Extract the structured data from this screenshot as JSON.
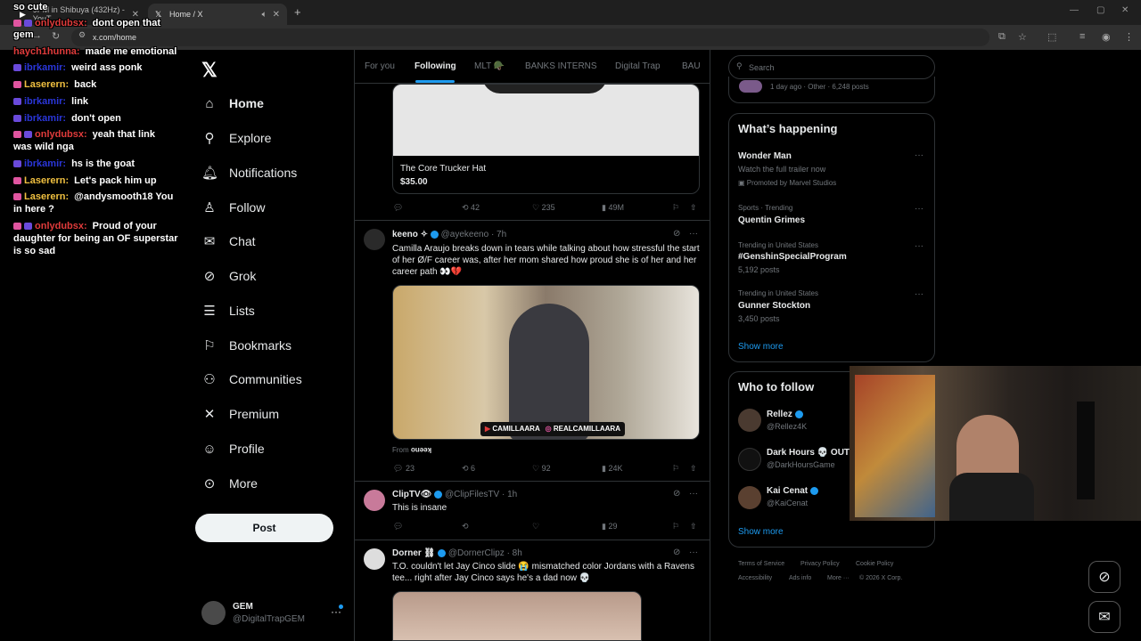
{
  "browser": {
    "tabs": [
      {
        "label": "9PM in Shibuya (432Hz) - YouT",
        "close": "✕"
      },
      {
        "label": "Home / X",
        "close": "✕"
      }
    ],
    "new_tab": "+",
    "url": "x.com/home"
  },
  "sidebar": {
    "logo": "𝕏",
    "items": [
      {
        "label": "Home",
        "icon": "home-icon",
        "glyph": "⌂"
      },
      {
        "label": "Explore",
        "icon": "search-icon",
        "glyph": "⚲"
      },
      {
        "label": "Notifications",
        "icon": "bell-icon",
        "glyph": "🔔︎"
      },
      {
        "label": "Follow",
        "icon": "person-add-icon",
        "glyph": "♙"
      },
      {
        "label": "Chat",
        "icon": "mail-icon",
        "glyph": "✉"
      },
      {
        "label": "Grok",
        "icon": "grok-icon",
        "glyph": "⊘"
      },
      {
        "label": "Lists",
        "icon": "list-icon",
        "glyph": "☰"
      },
      {
        "label": "Bookmarks",
        "icon": "bookmark-icon",
        "glyph": "⚐"
      },
      {
        "label": "Communities",
        "icon": "communities-icon",
        "glyph": "⚇"
      },
      {
        "label": "Premium",
        "icon": "x-icon",
        "glyph": "✕"
      },
      {
        "label": "Profile",
        "icon": "profile-icon",
        "glyph": "☺"
      },
      {
        "label": "More",
        "icon": "more-circle-icon",
        "glyph": "⊙"
      }
    ],
    "post_label": "Post",
    "account": {
      "name": "GEM",
      "handle": "@DigitalTrapGEM",
      "more": "···"
    }
  },
  "feed": {
    "tabs": [
      "For you",
      "Following",
      "MLT 🪖",
      "BANKS INTERNS",
      "Digital Trap",
      "BAU"
    ],
    "active_tab": "Following",
    "post1": {
      "card_title": "The Core Trucker Hat",
      "card_price": "$35.00",
      "replies": "",
      "reposts": "42",
      "likes": "235",
      "views": "49M"
    },
    "post2": {
      "name": "keeno ✧",
      "handle": "@ayekeeno",
      "time": "· 7h",
      "text": "Camilla Araujo breaks down in tears while talking about how stressful the start of her Ø/F career was, after her mom shared how proud she is of her and her career path 👀💔",
      "media_labels": [
        "CAMILLAARA",
        "REALCAMILLAARA"
      ],
      "from": "From",
      "from_name": "keeno",
      "replies": "23",
      "reposts": "6",
      "likes": "92",
      "views": "24K"
    },
    "post3": {
      "name": "ClipTV👁",
      "handle": "@ClipFilesTV",
      "time": "· 1h",
      "text": "This is insane",
      "views": "29"
    },
    "post4": {
      "name": "Dorner ⛓",
      "handle": "@DornerClipz",
      "time": "· 8h",
      "text": "T.O. couldn't let Jay Cinco slide 😭 mismatched color Jordans with a Ravens tee... right after Jay Cinco says he's a dad now 💀"
    }
  },
  "right": {
    "search_placeholder": "Search",
    "top_snippet": "1 day ago · Other · 6,248 posts",
    "happening": {
      "title": "What’s happening",
      "trends": [
        {
          "small": "",
          "main": "Wonder Man",
          "sub": "Watch the full trailer now",
          "promo": "Promoted by Marvel Studios"
        },
        {
          "small": "Sports · Trending",
          "main": "Quentin Grimes",
          "sub": ""
        },
        {
          "small": "Trending in United States",
          "main": "#GenshinSpecialProgram",
          "sub": "5,192 posts"
        },
        {
          "small": "Trending in United States",
          "main": "Gunner Stockton",
          "sub": "3,450 posts"
        }
      ],
      "show_more": "Show more"
    },
    "who_to_follow": {
      "title": "Who to follow",
      "users": [
        {
          "name": "Rellez",
          "handle": "@Rellez4K"
        },
        {
          "name": "Dark Hours 💀 OUT",
          "handle": "@DarkHoursGame"
        },
        {
          "name": "Kai Cenat",
          "handle": "@KaiCenat"
        }
      ],
      "show_more": "Show more"
    },
    "footer": [
      "Terms of Service",
      "Privacy Policy",
      "Cookie Policy",
      "Accessibility",
      "Ads info",
      "More ···",
      "© 2026 X Corp."
    ]
  },
  "chat": [
    {
      "user": "so cute",
      "msg": "",
      "color": "#ffffff"
    },
    {
      "user": "onlydubsx:",
      "msg": "dont open that",
      "color": "#e03b3b"
    },
    {
      "user": "gem",
      "msg": "",
      "color": "#ffffff"
    },
    {
      "user": "haych1hunna:",
      "msg": "made me emotional",
      "color": "#e03b3b"
    },
    {
      "user": "ibrkamir:",
      "msg": "weird ass ponk",
      "color": "#2a36d9"
    },
    {
      "user": "Laserern:",
      "msg": "back",
      "color": "#f0c040"
    },
    {
      "user": "ibrkamir:",
      "msg": "link",
      "color": "#2a36d9"
    },
    {
      "user": "ibrkamir:",
      "msg": "don't open",
      "color": "#2a36d9"
    },
    {
      "user": "onlydubsx:",
      "msg": "yeah that link",
      "color": "#e03b3b"
    },
    {
      "user": "",
      "msg": "was wild nga",
      "color": "#ffffff"
    },
    {
      "user": "ibrkamir:",
      "msg": "hs is the goat",
      "color": "#2a36d9"
    },
    {
      "user": "Laserern:",
      "msg": "Let's pack him up",
      "color": "#f0c040"
    },
    {
      "user": "Laserern:",
      "msg": "@andysmooth18 You",
      "color": "#f0c040"
    },
    {
      "user": "",
      "msg": "in here ?",
      "color": "#ffffff"
    },
    {
      "user": "onlydubsx:",
      "msg": "Proud of your",
      "color": "#e03b3b"
    },
    {
      "user": "",
      "msg": "daughter for being an OF superstar",
      "color": "#ffffff"
    },
    {
      "user": "",
      "msg": "is so sad",
      "color": "#ffffff"
    }
  ]
}
